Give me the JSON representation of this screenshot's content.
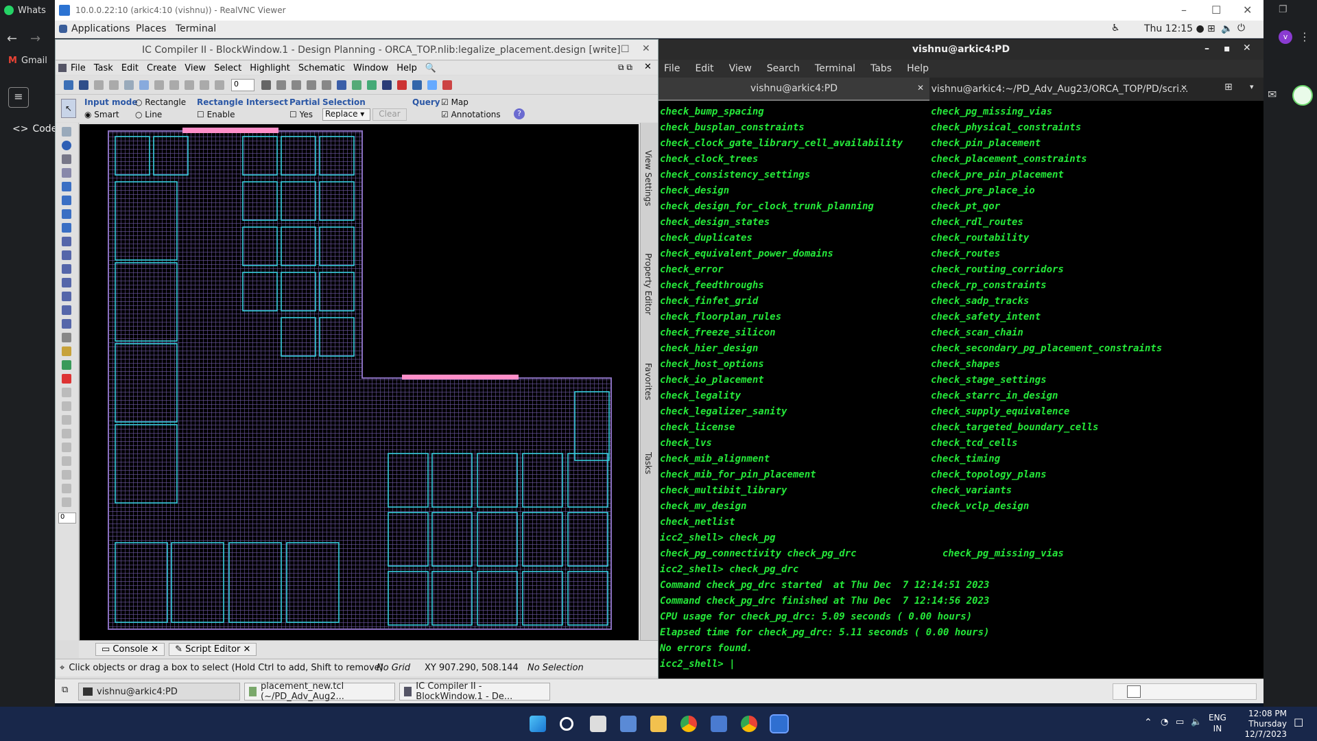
{
  "host": {
    "tab_title": "Whats",
    "gmail_label": "Gmail",
    "code_label": "Code"
  },
  "vnc": {
    "title": "10.0.0.22:10 (arkic4:10 (vishnu)) - RealVNC Viewer"
  },
  "gnome_panel": {
    "applications": "Applications",
    "places": "Places",
    "terminal": "Terminal",
    "clock": "Thu 12:15 ●"
  },
  "icc": {
    "title": "IC Compiler II - BlockWindow.1 - Design Planning - ORCA_TOP.nlib:legalize_placement.design [write]",
    "menu": [
      "File",
      "Task",
      "Edit",
      "Create",
      "View",
      "Select",
      "Highlight",
      "Schematic",
      "Window",
      "Help"
    ],
    "zoom_value": "0",
    "input_mode_label": "Input mode",
    "rectangle": "Rectangle",
    "smart": "Smart",
    "line": "Line",
    "rect_intersect_label": "Rectangle Intersect",
    "enable": "Enable",
    "partial_label": "Partial",
    "yes": "Yes",
    "selection_label": "Selection",
    "selection_value": "Replace",
    "clear": "Clear",
    "query_label": "Query",
    "map": "Map",
    "annotations": "Annotations",
    "side_tabs": [
      "View Settings",
      "Property Editor",
      "Favorites",
      "Tasks"
    ],
    "console_tab": "Console",
    "script_tab": "Script Editor",
    "status_hint": "Click objects or drag a box to select (Hold Ctrl to add, Shift to remove)",
    "grid": "No Grid",
    "xy": "XY 907.290, 508.144",
    "selection_status": "No Selection",
    "left_tool_value": "0"
  },
  "terminal": {
    "title": "vishnu@arkic4:PD",
    "menu": [
      "File",
      "Edit",
      "View",
      "Search",
      "Terminal",
      "Tabs",
      "Help"
    ],
    "tab1": "vishnu@arkic4:PD",
    "tab2": "vishnu@arkic4:~/PD_Adv_Aug23/ORCA_TOP/PD/scri...",
    "lines": [
      [
        "check_bump_spacing",
        "check_pg_missing_vias"
      ],
      [
        "check_busplan_constraints",
        "check_physical_constraints"
      ],
      [
        "check_clock_gate_library_cell_availability",
        "check_pin_placement"
      ],
      [
        "check_clock_trees",
        "check_placement_constraints"
      ],
      [
        "check_consistency_settings",
        "check_pre_pin_placement"
      ],
      [
        "check_design",
        "check_pre_place_io"
      ],
      [
        "check_design_for_clock_trunk_planning",
        "check_pt_qor"
      ],
      [
        "check_design_states",
        "check_rdl_routes"
      ],
      [
        "check_duplicates",
        "check_routability"
      ],
      [
        "check_equivalent_power_domains",
        "check_routes"
      ],
      [
        "check_error",
        "check_routing_corridors"
      ],
      [
        "check_feedthroughs",
        "check_rp_constraints"
      ],
      [
        "check_finfet_grid",
        "check_sadp_tracks"
      ],
      [
        "check_floorplan_rules",
        "check_safety_intent"
      ],
      [
        "check_freeze_silicon",
        "check_scan_chain"
      ],
      [
        "check_hier_design",
        "check_secondary_pg_placement_constraints"
      ],
      [
        "check_host_options",
        "check_shapes"
      ],
      [
        "check_io_placement",
        "check_stage_settings"
      ],
      [
        "check_legality",
        "check_starrc_in_design"
      ],
      [
        "check_legalizer_sanity",
        "check_supply_equivalence"
      ],
      [
        "check_license",
        "check_targeted_boundary_cells"
      ],
      [
        "check_lvs",
        "check_tcd_cells"
      ],
      [
        "check_mib_alignment",
        "check_timing"
      ],
      [
        "check_mib_for_pin_placement",
        "check_topology_plans"
      ],
      [
        "check_multibit_library",
        "check_variants"
      ],
      [
        "check_mv_design",
        "check_vclp_design"
      ],
      [
        "check_netlist",
        ""
      ],
      [
        "icc2_shell> check_pg",
        ""
      ],
      [
        "check_pg_connectivity check_pg_drc",
        "  check_pg_missing_vias"
      ],
      [
        "icc2_shell> check_pg_drc",
        ""
      ],
      [
        "Command check_pg_drc started  at Thu Dec  7 12:14:51 2023",
        ""
      ],
      [
        "Command check_pg_drc finished at Thu Dec  7 12:14:56 2023",
        ""
      ],
      [
        "CPU usage for check_pg_drc: 5.09 seconds ( 0.00 hours)",
        ""
      ],
      [
        "Elapsed time for check_pg_drc: 5.11 seconds ( 0.00 hours)",
        ""
      ],
      [
        "No errors found.",
        ""
      ],
      [
        "icc2_shell> ",
        ""
      ]
    ]
  },
  "gnome_bottom": {
    "tasks": [
      "vishnu@arkic4:PD",
      "placement_new.tcl (~/PD_Adv_Aug2...",
      "IC Compiler II - BlockWindow.1 - De..."
    ]
  },
  "windows_taskbar": {
    "lang1": "ENG",
    "lang2": "IN",
    "time": "12:08 PM",
    "day": "Thursday",
    "date": "12/7/2023"
  },
  "colors": {
    "terminal_text": "#25e83a",
    "layout_grid": "#7a5fa8",
    "macro_outline": "#37d0e0",
    "port": "#ff8fc8"
  }
}
